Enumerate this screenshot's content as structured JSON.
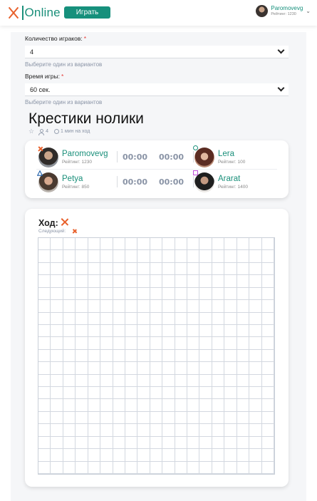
{
  "header": {
    "logo_text": "Online",
    "play_button": "Играть",
    "user": {
      "name": "Paromovevg",
      "rating": "Рейтинг: 1230"
    }
  },
  "form": {
    "players_label": "Количество играков:",
    "players_value": "4",
    "players_hint": "Выберите один из вариантов",
    "time_label": "Время игры:",
    "time_value": "60 сек.",
    "time_hint": "Выберите один из вариантов",
    "required_mark": "*"
  },
  "game": {
    "title": "Крестики нолики",
    "players_count": "4",
    "turn_time": "1 мин на ход"
  },
  "players": [
    {
      "name": "Paromovevg",
      "rating": "Рейтинг: 1230",
      "mark": "x",
      "timer": "00:00"
    },
    {
      "name": "Lera",
      "rating": "Рейтинг: 100",
      "mark": "o",
      "timer": "00:00"
    },
    {
      "name": "Petya",
      "rating": "Рейтинг: 850",
      "mark": "triangle",
      "timer": "00:00"
    },
    {
      "name": "Ararat",
      "rating": "Рейтинг: 1400",
      "mark": "square",
      "timer": "00:00"
    }
  ],
  "board": {
    "turn_label": "Ход:",
    "next_label": "Следующий:",
    "current_mark": "x",
    "next_mark": "x",
    "size": 19
  },
  "colors": {
    "accent": "#16907c",
    "x_mark": "#e8612c",
    "o_mark": "#1a8f7a",
    "square_mark": "#c04dd9",
    "triangle_mark": "#1f5fa8",
    "required": "#e53935"
  }
}
